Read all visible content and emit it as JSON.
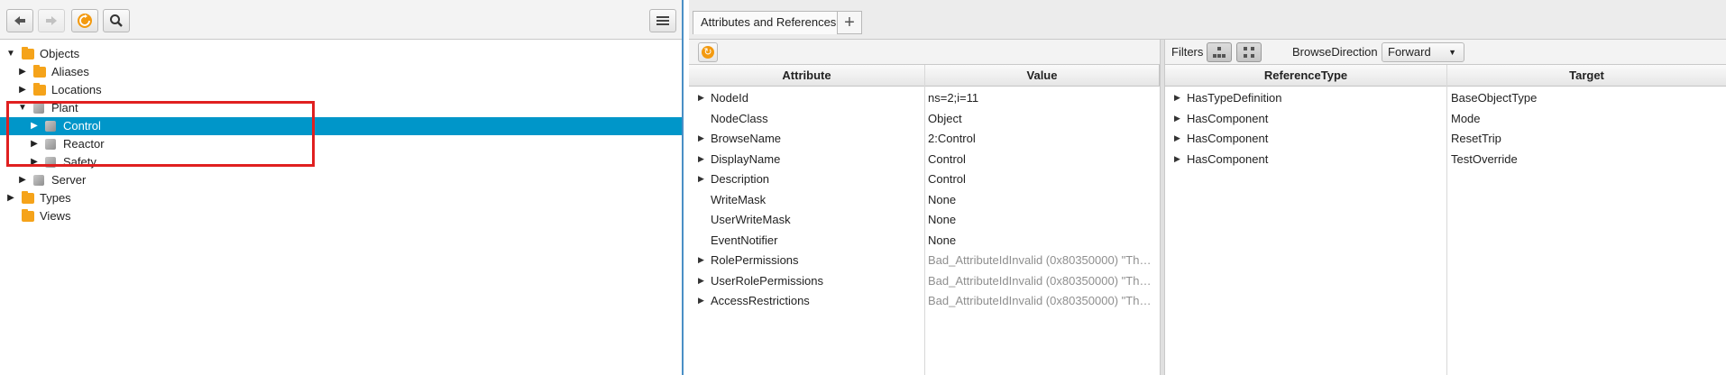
{
  "left_toolbar": {
    "back_icon": "arrow-left",
    "forward_icon": "arrow-right",
    "refresh_icon": "refresh",
    "search_icon": "magnifier",
    "menu_icon": "hamburger"
  },
  "tree": [
    {
      "label": "Objects",
      "icon": "folder",
      "expanded": true,
      "level": 0
    },
    {
      "label": "Aliases",
      "icon": "folder",
      "expanded": false,
      "level": 1
    },
    {
      "label": "Locations",
      "icon": "folder",
      "expanded": false,
      "level": 1
    },
    {
      "label": "Plant",
      "icon": "cube",
      "expanded": true,
      "level": 1
    },
    {
      "label": "Control",
      "icon": "cube",
      "expanded": false,
      "level": 2,
      "selected": true
    },
    {
      "label": "Reactor",
      "icon": "cube",
      "expanded": false,
      "level": 2
    },
    {
      "label": "Safety",
      "icon": "cube",
      "expanded": false,
      "level": 2
    },
    {
      "label": "Server",
      "icon": "cube",
      "expanded": false,
      "level": 1
    },
    {
      "label": "Types",
      "icon": "folder",
      "expanded": false,
      "level": 0
    },
    {
      "label": "Views",
      "icon": "folder",
      "expanded": false,
      "level": 0,
      "leaf": true
    }
  ],
  "tabs": {
    "active": "Attributes and References",
    "add": "+"
  },
  "attributes": {
    "headers": {
      "attribute": "Attribute",
      "value": "Value"
    },
    "rows": [
      {
        "name": "NodeId",
        "value": "ns=2;i=11",
        "expandable": true,
        "error": false
      },
      {
        "name": "NodeClass",
        "value": "Object",
        "expandable": false,
        "error": false
      },
      {
        "name": "BrowseName",
        "value": "2:Control",
        "expandable": true,
        "error": false
      },
      {
        "name": "DisplayName",
        "value": "Control",
        "expandable": true,
        "error": false
      },
      {
        "name": "Description",
        "value": "Control",
        "expandable": true,
        "error": false
      },
      {
        "name": "WriteMask",
        "value": "None",
        "expandable": false,
        "error": false
      },
      {
        "name": "UserWriteMask",
        "value": "None",
        "expandable": false,
        "error": false
      },
      {
        "name": "EventNotifier",
        "value": "None",
        "expandable": false,
        "error": false
      },
      {
        "name": "RolePermissions",
        "value": "Bad_AttributeIdInvalid (0x80350000) \"The ...",
        "expandable": true,
        "error": true
      },
      {
        "name": "UserRolePermissions",
        "value": "Bad_AttributeIdInvalid (0x80350000) \"The ...",
        "expandable": true,
        "error": true
      },
      {
        "name": "AccessRestrictions",
        "value": "Bad_AttributeIdInvalid (0x80350000) \"The ...",
        "expandable": true,
        "error": true
      }
    ]
  },
  "references": {
    "filters_label": "Filters",
    "browse_direction_label": "BrowseDirection",
    "browse_direction_value": "Forward",
    "headers": {
      "type": "ReferenceType",
      "target": "Target"
    },
    "rows": [
      {
        "type": "HasTypeDefinition",
        "target": "BaseObjectType"
      },
      {
        "type": "HasComponent",
        "target": "Mode"
      },
      {
        "type": "HasComponent",
        "target": "ResetTrip"
      },
      {
        "type": "HasComponent",
        "target": "TestOverride"
      }
    ]
  },
  "colors": {
    "selection": "#0096c9",
    "highlight_box": "#e02020",
    "folder": "#f5a31a",
    "refresh": "#f39a10"
  }
}
